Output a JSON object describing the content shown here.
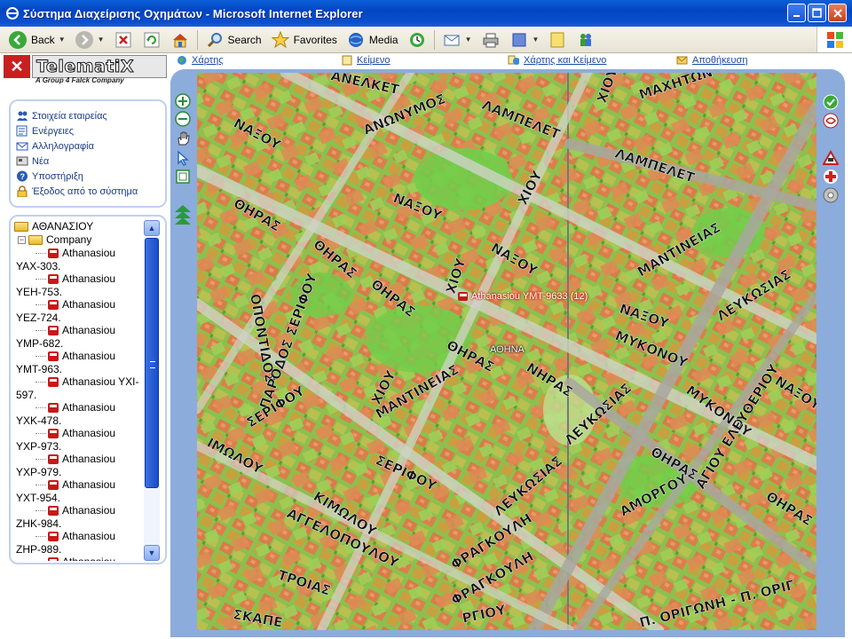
{
  "window": {
    "title": "Σύστημα Διαχείρισης Οχημάτων - Microsoft Internet Explorer"
  },
  "toolbar": {
    "back": "Back",
    "search": "Search",
    "favorites": "Favorites",
    "media": "Media"
  },
  "logo": {
    "name": "TelematiX",
    "tagline": "A Group 4 Falck Company"
  },
  "tabs": [
    "Χάρτης",
    "Κείμενο",
    "Χάρτης και Κείμενο",
    "Αποθήκευση"
  ],
  "menu": [
    {
      "label": "Στοιχεία εταιρείας",
      "icon": "people-icon"
    },
    {
      "label": "Ενέργειες",
      "icon": "actions-icon"
    },
    {
      "label": "Αλληλογραφία",
      "icon": "mail-icon"
    },
    {
      "label": "Νέα",
      "icon": "news-icon"
    },
    {
      "label": "Υποστήριξη",
      "icon": "help-icon"
    },
    {
      "label": "Έξοδος από το σύστημα",
      "icon": "lock-icon"
    }
  ],
  "tree": {
    "root": "ΑΘΑΝΑΣΙΟΥ",
    "group": "Company",
    "vehicles": [
      {
        "line1": "Athanasiou",
        "line2": "YAX-303."
      },
      {
        "line1": "Athanasiou",
        "line2": "YEH-753."
      },
      {
        "line1": "Athanasiou",
        "line2": "YEZ-724."
      },
      {
        "line1": "Athanasiou",
        "line2": "YMP-682."
      },
      {
        "line1": "Athanasiou",
        "line2": "YMT-963."
      },
      {
        "line1": "Athanasiou YXI-",
        "line2": "597."
      },
      {
        "line1": "Athanasiou",
        "line2": "YXK-478."
      },
      {
        "line1": "Athanasiou",
        "line2": "YXP-973."
      },
      {
        "line1": "Athanasiou",
        "line2": "YXP-979."
      },
      {
        "line1": "Athanasiou",
        "line2": "YXT-954."
      },
      {
        "line1": "Athanasiou",
        "line2": "ZHK-984."
      },
      {
        "line1": "Athanasiou",
        "line2": "ZHP-989."
      },
      {
        "line1": "Athanasiou",
        "line2": ""
      }
    ]
  },
  "map": {
    "marker": "Athanasiou YMT-9633 (12)",
    "city": "ΑΘΗΝΑ",
    "streets": [
      "ΑΝΕΛΚΕΤ",
      "ΛΑΜΠΕΛΕΤ",
      "ΧΙΟΥ",
      "ΜΑΧΗΤΩΝ",
      "ΝΑΞΟΥ",
      "ΑΝΩΝΥΜΟΣ",
      "ΝΑΞΟΥ",
      "ΧΙΟΥ",
      "ΛΑΜΠΕΛΕΤ",
      "ΘΗΡΑΣ",
      "ΘΗΡΑΣ",
      "ΘΗΡΑΣ",
      "ΝΑΞΟΥ",
      "ΜΑΝΤΙΝΕΙΑΣ",
      "ΧΙΟΥ",
      "ΟΠΟΝΤΙΔΟΣ",
      "ΠΑΡΟΔΟΣ ΣΕΡΙΦΟΥ",
      "ΘΗΡΑΣ",
      "ΝΑΞΟΥ",
      "ΛΕΥΚΩΣΙΑΣ",
      "ΜΥΚΟΝΟΥ",
      "ΧΙΟΥ",
      "ΝΗΡΑΣ",
      "ΜΑΝΤΙΝΕΙΑΣ",
      "ΛΕΥΚΩΣΙΑΣ",
      "ΜΥΚΟΝΟΥ",
      "ΝΑΞΟΥ",
      "ΙΜΩΛΟΥ",
      "ΣΕΡΙΦΟΥ",
      "ΘΗΡΑΣ",
      "ΣΕΡΙΦΟΥ",
      "ΛΕΥΚΩΣΙΑΣ",
      "ΚΙΜΩΛΟΥ",
      "ΑΓΓΕΛΟΠΟΥΛΟΥ",
      "ΑΜΟΡΓΟΥ",
      "ΑΓΙΟΥ ΕΛΕΥΘΕΡΙΟΥ",
      "ΘΗΡΑΣ",
      "ΦΡΑΓΚΟΥΛΗ",
      "ΤΡΟΙΑΣ",
      "ΦΡΑΓΚΟΥΛΗ",
      "ΣΚΑΠΕ",
      "ΡΓΙΟΥ",
      "Π. ΟΡΙΓΩΝΗ - Π. ΟΡΙΓ"
    ]
  },
  "colors": {
    "titlebar": "#0245c0",
    "frame": "#8cacdc",
    "link": "#1a4aa8",
    "map_green": "#7fbf45",
    "map_orange": "#d9804a"
  }
}
